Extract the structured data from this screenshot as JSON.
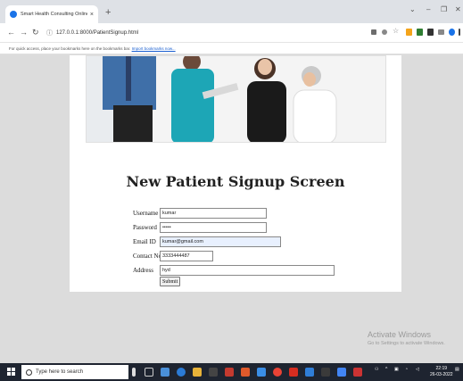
{
  "browser": {
    "tab_title": "Smart Health Consulting Online",
    "tab_close": "×",
    "new_tab": "+",
    "url": "127.0.0.1:8000/PatientSignup.html",
    "bookmarks_hint": "For quick access, place your bookmarks here on the bookmarks bar.",
    "bookmarks_link": "Import bookmarks now..."
  },
  "page": {
    "heading": "New Patient Signup Screen",
    "form": {
      "username": {
        "label": "Username",
        "value": "kumar"
      },
      "password": {
        "label": "Password",
        "value": "•••••"
      },
      "email": {
        "label": "Email ID",
        "value": "kumar@gmail.com"
      },
      "contact": {
        "label": "Contact No",
        "value": "3333444487"
      },
      "address": {
        "label": "Address",
        "value": "hyd"
      },
      "submit_label": "Submit"
    }
  },
  "watermark": {
    "title": "Activate Windows",
    "subtitle": "Go to Settings to activate Windows."
  },
  "taskbar": {
    "search_placeholder": "Type here to search",
    "time": "22:19",
    "date": "26-03-2022"
  },
  "colors": {
    "link": "#1a5fd0",
    "autofill": "#e8f0fe",
    "taskbar": "#1e2430"
  }
}
